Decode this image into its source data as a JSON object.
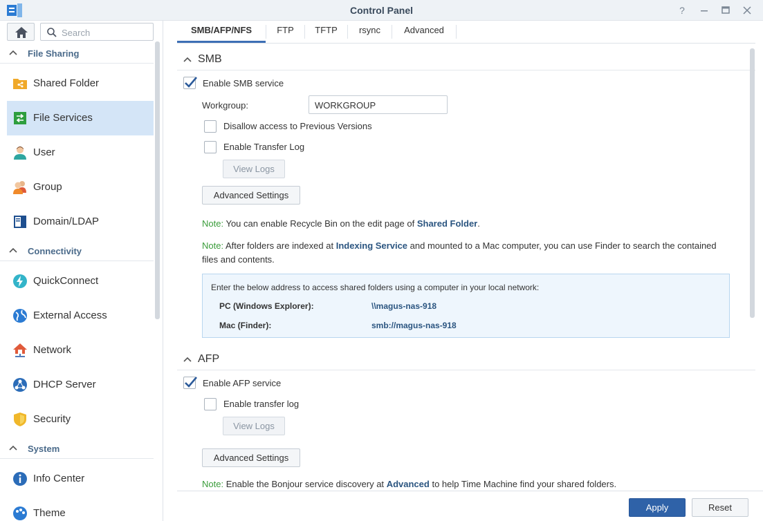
{
  "window": {
    "title": "Control Panel",
    "controls": [
      "help-icon",
      "minimize-icon",
      "maximize-icon",
      "close-icon"
    ]
  },
  "sidebar": {
    "search_placeholder": "Search",
    "categories": {
      "file_sharing": "File Sharing",
      "connectivity": "Connectivity",
      "system": "System"
    },
    "items": [
      {
        "label": "Shared Folder",
        "icon": "shared-folder-icon"
      },
      {
        "label": "File Services",
        "icon": "file-services-icon",
        "active": true
      },
      {
        "label": "User",
        "icon": "user-icon"
      },
      {
        "label": "Group",
        "icon": "group-icon"
      },
      {
        "label": "Domain/LDAP",
        "icon": "domain-icon"
      },
      {
        "label": "QuickConnect",
        "icon": "quickconnect-icon"
      },
      {
        "label": "External Access",
        "icon": "globe-icon"
      },
      {
        "label": "Network",
        "icon": "network-icon"
      },
      {
        "label": "DHCP Server",
        "icon": "dhcp-icon"
      },
      {
        "label": "Security",
        "icon": "shield-icon"
      },
      {
        "label": "Info Center",
        "icon": "info-icon"
      },
      {
        "label": "Theme",
        "icon": "theme-icon"
      }
    ]
  },
  "tabs": [
    {
      "label": "SMB/AFP/NFS",
      "active": true
    },
    {
      "label": "FTP"
    },
    {
      "label": "TFTP"
    },
    {
      "label": "rsync"
    },
    {
      "label": "Advanced"
    }
  ],
  "smb": {
    "title": "SMB",
    "enable_label": "Enable SMB service",
    "enable_checked": true,
    "workgroup_label": "Workgroup:",
    "workgroup_value": "WORKGROUP",
    "disallow_label": "Disallow access to Previous Versions",
    "transfer_log_label": "Enable Transfer Log",
    "view_logs": "View Logs",
    "advanced_settings": "Advanced Settings",
    "note_label": "Note:",
    "note1_pre": "You can enable Recycle Bin on the edit page of",
    "note1_link": "Shared Folder",
    "note1_post": ".",
    "note2_pre": "After folders are indexed at",
    "note2_link": "Indexing Service",
    "note2_post": "and mounted to a Mac computer, you can use Finder to search the contained",
    "note2_line2": "files and contents.",
    "info_intro": "Enter the below address to access shared folders using a computer in your local network:",
    "pc_label": "PC (Windows Explorer):",
    "pc_value": "\\\\magus-nas-918",
    "mac_label": "Mac (Finder):",
    "mac_value": "smb://magus-nas-918"
  },
  "afp": {
    "title": "AFP",
    "enable_label": "Enable AFP service",
    "enable_checked": true,
    "transfer_log_label": "Enable transfer log",
    "view_logs": "View Logs",
    "advanced_settings": "Advanced Settings",
    "note_label": "Note:",
    "note_pre": "Enable the Bonjour service discovery at",
    "note_link": "Advanced",
    "note_post": "to help Time Machine find your shared folders."
  },
  "footer": {
    "apply": "Apply",
    "reset": "Reset"
  }
}
